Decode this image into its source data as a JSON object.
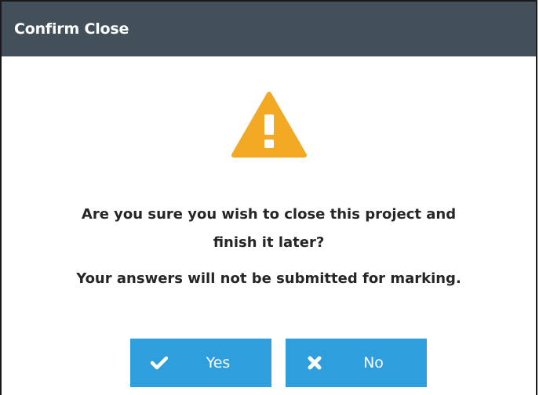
{
  "dialog": {
    "title": "Confirm Close",
    "icon": "warning-icon",
    "message_line1": "Are you sure you wish to close this project and",
    "message_line2": "finish it later?",
    "message_secondary": "Your answers will not be submitted for marking."
  },
  "buttons": {
    "yes": {
      "label": "Yes",
      "icon": "check-icon"
    },
    "no": {
      "label": "No",
      "icon": "x-icon"
    }
  },
  "colors": {
    "titlebar": "#435059",
    "button": "#2e9edd",
    "warning": "#f2a924",
    "text": "#262626"
  }
}
